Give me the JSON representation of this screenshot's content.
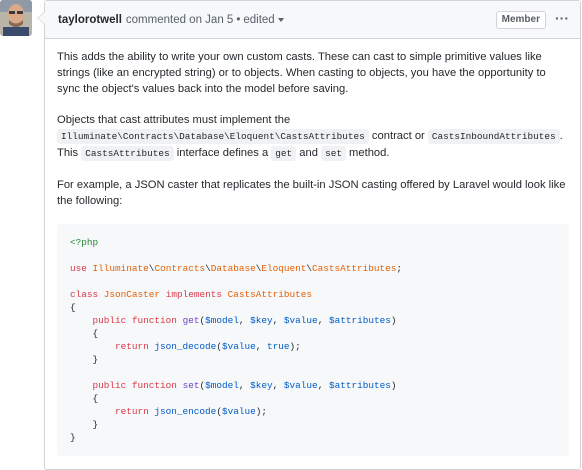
{
  "header": {
    "author": "taylorotwell",
    "action": "commented on Jan 5",
    "separator": "•",
    "edited": "edited",
    "badge": "Member",
    "more": "···"
  },
  "body": {
    "p1": "This adds the ability to write your own custom casts. These can cast to simple primitive values like strings (like an encrypted string) or to objects. When casting to objects, you have the opportunity to sync the object's values back into the model before saving.",
    "p2": {
      "t1": "Objects that cast attributes must implement the ",
      "c1": "Illuminate\\Contracts\\Database\\Eloquent\\CastsAttributes",
      "t2": " contract or ",
      "c2": "CastsInboundAttributes",
      "t3": ". This ",
      "c3": "CastsAttributes",
      "t4": " interface defines a ",
      "c4": "get",
      "t5": " and ",
      "c5": "set",
      "t6": " method."
    },
    "p3": "For example, a JSON caster that replicates the built-in JSON casting offered by Laravel would look like the following:"
  },
  "code": {
    "open_tag": "<?php",
    "use_kw": "use",
    "ns1": "Illuminate",
    "ns2": "Contracts",
    "ns3": "Database",
    "ns4": "Eloquent",
    "ns5": "CastsAttributes",
    "bs": "\\",
    "semi": ";",
    "class_kw": "class",
    "class_name": "JsonCaster",
    "implements_kw": "implements",
    "iface": "CastsAttributes",
    "brace_open": "{",
    "brace_close": "}",
    "public_kw": "public",
    "function_kw": "function",
    "get_name": "get",
    "set_name": "set",
    "params_open": "(",
    "p_model": "$model",
    "p_key": "$key",
    "p_value": "$value",
    "p_attributes": "$attributes",
    "comma": ", ",
    "params_close": ")",
    "return_kw": "return",
    "json_decode": "json_decode",
    "json_encode": "json_encode",
    "true_kw": "true",
    "close_call": ");"
  }
}
